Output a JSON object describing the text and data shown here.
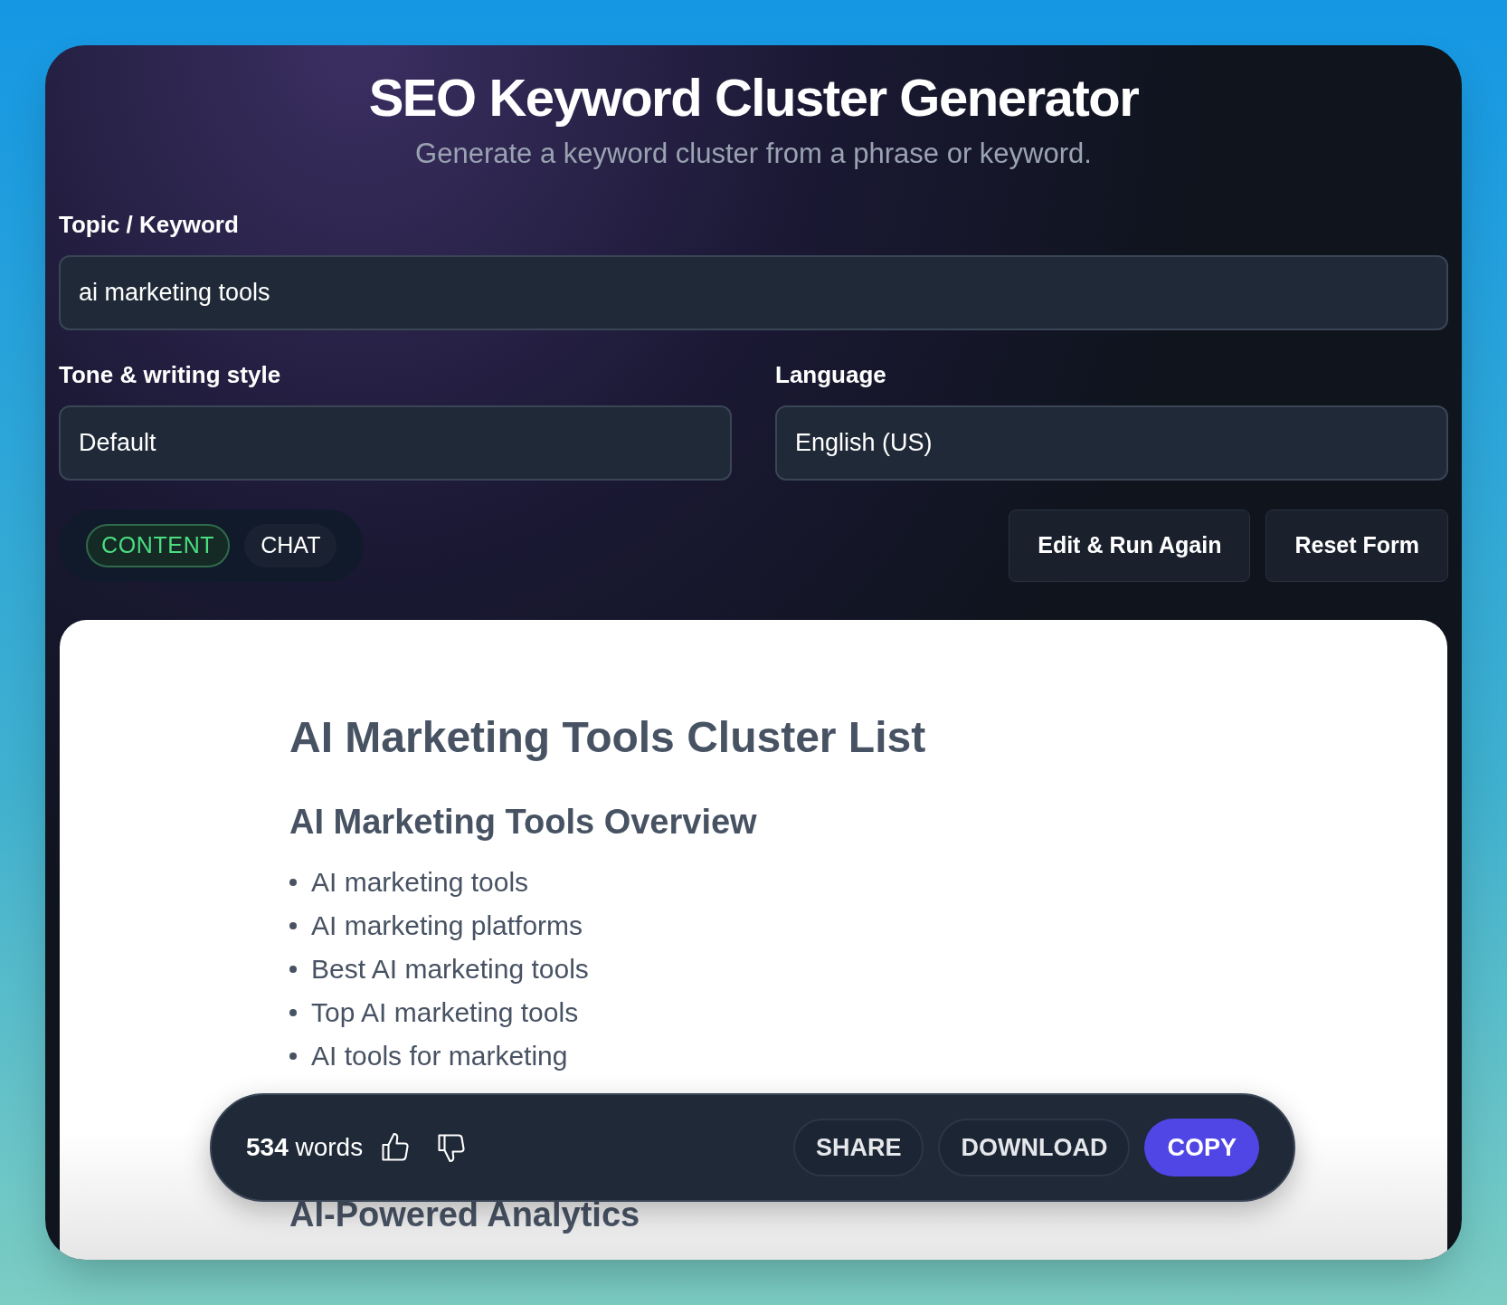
{
  "header": {
    "title": "SEO Keyword Cluster Generator",
    "subtitle": "Generate a keyword cluster from a phrase or keyword."
  },
  "topic": {
    "label": "Topic / Keyword",
    "value": "ai marketing tools"
  },
  "tone": {
    "label": "Tone & writing style",
    "value": "Default"
  },
  "language": {
    "label": "Language",
    "value": "English (US)"
  },
  "modes": [
    {
      "label": "CONTENT",
      "selected": true
    },
    {
      "label": "CHAT",
      "selected": false
    }
  ],
  "actions": [
    "Edit & Run Again",
    "Reset Form"
  ],
  "document": {
    "title": "AI Marketing Tools Cluster List",
    "sections": [
      {
        "heading": "AI Marketing Tools Overview",
        "items": [
          "AI marketing tools",
          "AI marketing platforms",
          "Best AI marketing tools",
          "Top AI marketing tools",
          "AI tools for marketing"
        ]
      },
      {
        "heading": "AI-Powered Analytics"
      }
    ]
  },
  "footer_bar": {
    "count": "534",
    "count_unit": "words",
    "buttons": [
      {
        "label": "SHARE",
        "kind": "plain"
      },
      {
        "label": "DOWNLOAD",
        "kind": "plain"
      },
      {
        "label": "COPY",
        "kind": "primary"
      }
    ]
  }
}
